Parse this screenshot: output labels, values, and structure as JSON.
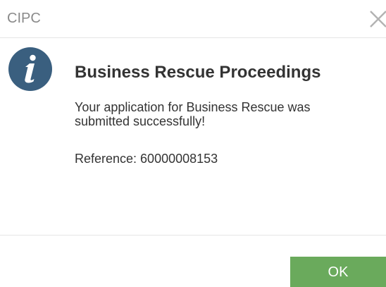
{
  "header": {
    "title": "CIPC",
    "close_icon": "close-icon"
  },
  "dialog": {
    "icon": "info-icon",
    "heading": "Business Rescue Proceedings",
    "message": "Your application for Business Rescue was submitted successfully!",
    "reference": "Reference: 60000008153"
  },
  "footer": {
    "ok_label": "OK"
  },
  "colors": {
    "info_icon_bg": "#3a5f7f",
    "ok_button_bg": "#6aaa5c",
    "header_text": "#8a8a8a",
    "body_text": "#333333"
  }
}
